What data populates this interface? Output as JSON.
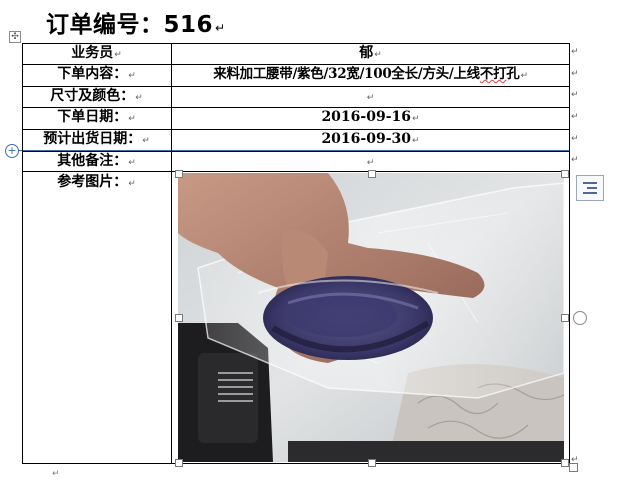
{
  "document": {
    "title": "订单编号：516",
    "paragraph_mark": "↵"
  },
  "table": {
    "rows": [
      {
        "label": "业务员",
        "value": "郁"
      },
      {
        "label": "下单内容：",
        "value": "来料加工腰带/紫色/32宽/100全长/方头/上线不打孔"
      },
      {
        "label": "尺寸及颜色：",
        "value": ""
      },
      {
        "label": "下单日期：",
        "value": "2016-09-16"
      },
      {
        "label": "预计出货日期：",
        "value": "2016-09-30"
      },
      {
        "label": "其他备注：",
        "value": ""
      },
      {
        "label": "参考图片：",
        "value": ""
      }
    ],
    "spellcheck_flag_text": "不打"
  },
  "icons": {
    "table_move": "table-move-icon",
    "row_insert": "row-insert-icon",
    "layout_options": "layout-options-icon",
    "rotate": "rotate-icon"
  },
  "colors": {
    "selection_accent": "#3b6fb0",
    "spellcheck_underline": "#e04040"
  }
}
